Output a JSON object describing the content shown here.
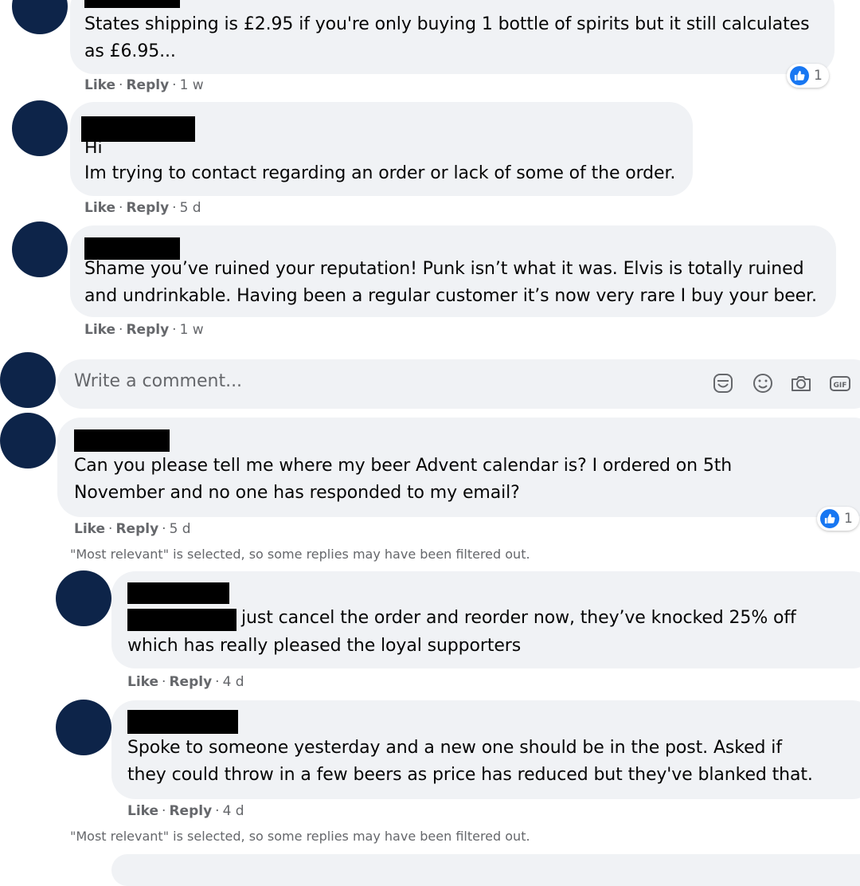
{
  "comments": [
    {
      "lines": [
        "States shipping is £2.95 if you're only buying 1 bottle of spirits but it still calculates",
        "as £6.95..."
      ],
      "like_label": "Like",
      "reply_label": "Reply",
      "time": "1 w",
      "reaction_count": "1"
    },
    {
      "lines": [
        "Hi",
        "Im trying to contact regarding an order or lack of some of the order."
      ],
      "like_label": "Like",
      "reply_label": "Reply",
      "time": "5 d"
    },
    {
      "lines": [
        "Shame you’ve ruined your reputation! Punk isn’t what it was. Elvis is totally ruined",
        "and undrinkable. Having been a regular customer it’s now very rare I buy your beer."
      ],
      "like_label": "Like",
      "reply_label": "Reply",
      "time": "1 w"
    }
  ],
  "composer": {
    "placeholder": "Write a comment...",
    "icons": [
      "sticker-icon",
      "emoji-icon",
      "camera-icon",
      "gif-icon"
    ]
  },
  "thread": {
    "lines": [
      "Can you please tell me where my beer Advent calendar is? I ordered on 5th",
      "November and no one has responded to my email?"
    ],
    "like_label": "Like",
    "reply_label": "Reply",
    "time": "5 d",
    "reaction_count": "1",
    "filter_notice": "\"Most relevant\" is selected, so some replies may have been filtered out.",
    "replies": [
      {
        "lines": [
          "just cancel the order and reorder now, they’ve knocked 25% off",
          "which has really pleased the loyal supporters"
        ],
        "like_label": "Like",
        "reply_label": "Reply",
        "time": "4 d"
      },
      {
        "lines": [
          "Spoke to someone yesterday and a new one should be in the post. Asked if",
          "they could throw in a few beers as price has reduced but they've blanked that."
        ],
        "like_label": "Like",
        "reply_label": "Reply",
        "time": "4 d"
      }
    ],
    "bottom_notice": "\"Most relevant\" is selected, so some replies may have been filtered out."
  },
  "colors": {
    "avatar": "#0d2449",
    "bubble": "#f0f2f5",
    "meta_text": "#65676b",
    "like_blue": "#1877f2"
  }
}
